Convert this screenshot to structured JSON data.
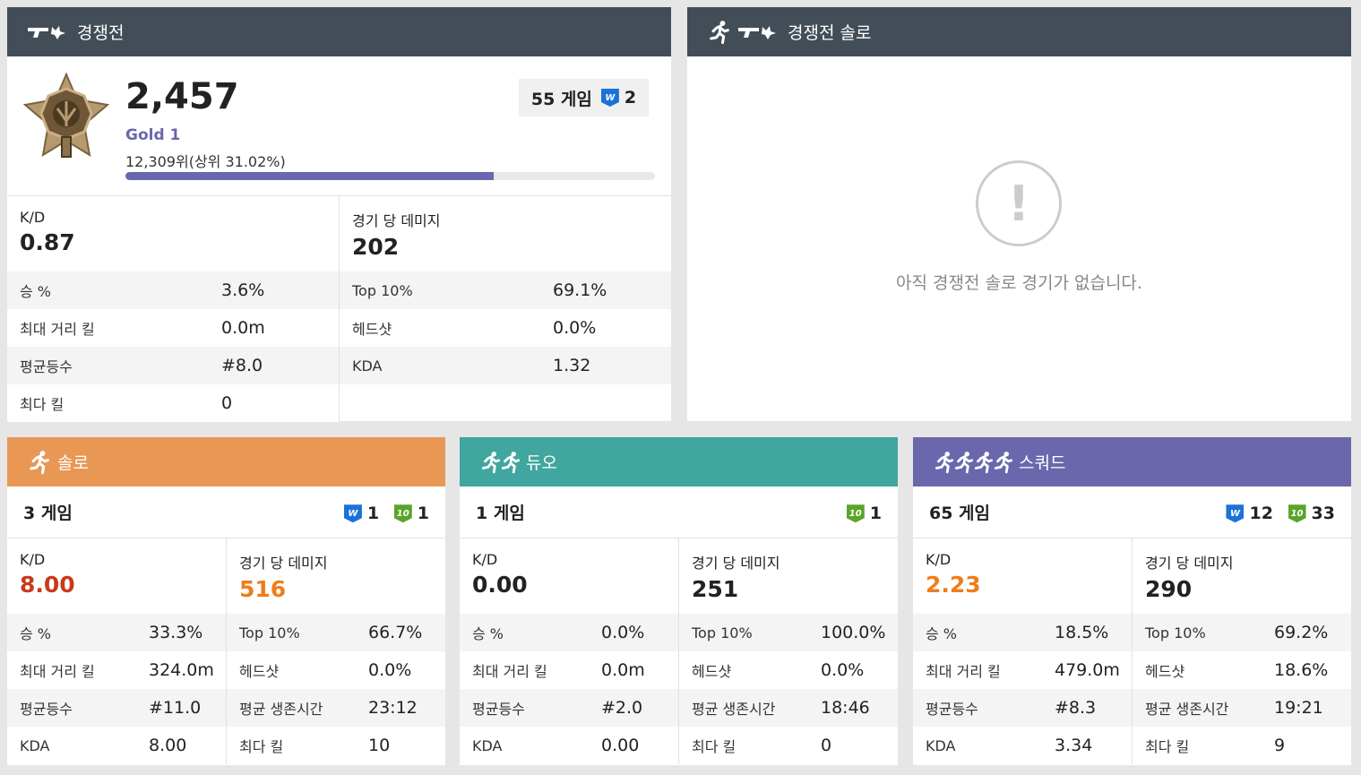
{
  "competitive": {
    "title": "경쟁전",
    "rating": "2,457",
    "tier": "Gold 1",
    "rank": "12,309위(상위 31.02%)",
    "progress": 0.695,
    "games": "55 게임",
    "wins": "2",
    "kd_label": "K/D",
    "kd": "0.87",
    "dmg_label": "경기 당 데미지",
    "dmg": "202",
    "left_rows": [
      {
        "k": "승 %",
        "v": "3.6%"
      },
      {
        "k": "최대 거리 킬",
        "v": "0.0m"
      },
      {
        "k": "평균등수",
        "v": "#8.0"
      },
      {
        "k": "최다 킬",
        "v": "0"
      }
    ],
    "right_rows": [
      {
        "k": "Top 10%",
        "v": "69.1%"
      },
      {
        "k": "헤드샷",
        "v": "0.0%"
      },
      {
        "k": "KDA",
        "v": "1.32"
      }
    ]
  },
  "competitive_solo": {
    "title": "경쟁전 솔로",
    "empty_message": "아직 경쟁전 솔로 경기가 없습니다.",
    "alert_mark": "!"
  },
  "solo": {
    "title": "솔로",
    "games": "3 게임",
    "wins": "1",
    "top10": "1",
    "kd_label": "K/D",
    "kd": "8.00",
    "kd_color": "#c93a1b",
    "dmg_label": "경기 당 데미지",
    "dmg": "516",
    "dmg_color": "#ef7d1a",
    "left_rows": [
      {
        "k": "승 %",
        "v": "33.3%"
      },
      {
        "k": "최대 거리 킬",
        "v": "324.0m"
      },
      {
        "k": "평균등수",
        "v": "#11.0"
      },
      {
        "k": "KDA",
        "v": "8.00"
      }
    ],
    "right_rows": [
      {
        "k": "Top 10%",
        "v": "66.7%"
      },
      {
        "k": "헤드샷",
        "v": "0.0%"
      },
      {
        "k": "평균 생존시간",
        "v": "23:12"
      },
      {
        "k": "최다 킬",
        "v": "10"
      }
    ]
  },
  "duo": {
    "title": "듀오",
    "games": "1 게임",
    "top10": "1",
    "kd_label": "K/D",
    "kd": "0.00",
    "dmg_label": "경기 당 데미지",
    "dmg": "251",
    "left_rows": [
      {
        "k": "승 %",
        "v": "0.0%"
      },
      {
        "k": "최대 거리 킬",
        "v": "0.0m"
      },
      {
        "k": "평균등수",
        "v": "#2.0"
      },
      {
        "k": "KDA",
        "v": "0.00"
      }
    ],
    "right_rows": [
      {
        "k": "Top 10%",
        "v": "100.0%"
      },
      {
        "k": "헤드샷",
        "v": "0.0%"
      },
      {
        "k": "평균 생존시간",
        "v": "18:46"
      },
      {
        "k": "최다 킬",
        "v": "0"
      }
    ]
  },
  "squad": {
    "title": "스쿼드",
    "games": "65 게임",
    "wins": "12",
    "top10": "33",
    "kd_label": "K/D",
    "kd": "2.23",
    "kd_color": "#ef7d1a",
    "dmg_label": "경기 당 데미지",
    "dmg": "290",
    "left_rows": [
      {
        "k": "승 %",
        "v": "18.5%"
      },
      {
        "k": "최대 거리 킬",
        "v": "479.0m"
      },
      {
        "k": "평균등수",
        "v": "#8.3"
      },
      {
        "k": "KDA",
        "v": "3.34"
      }
    ],
    "right_rows": [
      {
        "k": "Top 10%",
        "v": "69.2%"
      },
      {
        "k": "헤드샷",
        "v": "18.6%"
      },
      {
        "k": "평균 생존시간",
        "v": "19:21"
      },
      {
        "k": "최다 킬",
        "v": "9"
      }
    ]
  },
  "badges": {
    "win_mark": "W",
    "top10_mark": "10"
  }
}
